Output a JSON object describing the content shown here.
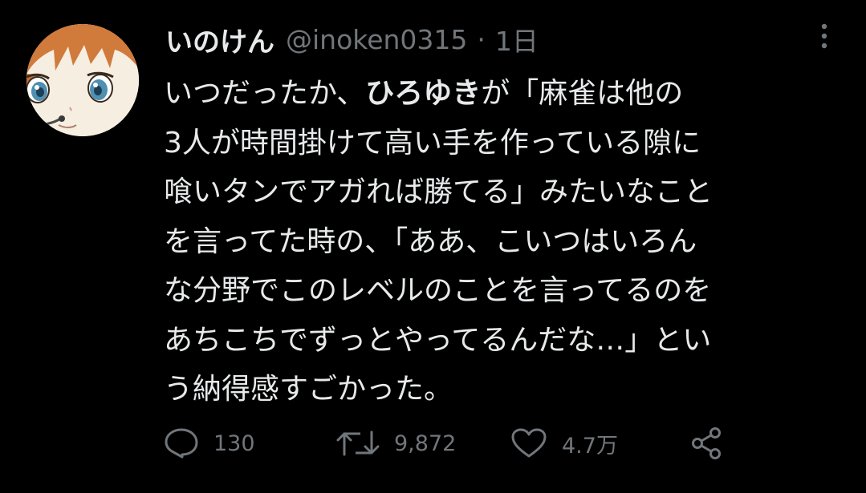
{
  "user": {
    "display_name": "いのけん",
    "handle": "@inoken0315",
    "separator": "·",
    "time": "1日"
  },
  "tweet": {
    "lines": [
      {
        "before": "いつだったか、",
        "mention": "ひろゆき",
        "after": "が「麻雀は他の"
      },
      {
        "text": "3人が時間掛けて高い手を作っている隙に"
      },
      {
        "text": "喰いタンでアガれば勝てる」みたいなこと"
      },
      {
        "text": "を言ってた時の、「ああ、こいつはいろん"
      },
      {
        "text": "な分野でこのレベルのことを言ってるのを"
      },
      {
        "text": "あちこちでずっとやってるんだな…」とい"
      },
      {
        "text": "う納得感すごかった。"
      }
    ]
  },
  "actions": {
    "reply": {
      "icon": "reply-icon",
      "count": "130"
    },
    "retweet": {
      "icon": "retweet-icon",
      "count": "9,872"
    },
    "like": {
      "icon": "heart-icon",
      "count": "4.7万"
    },
    "share": {
      "icon": "share-icon"
    }
  },
  "colors": {
    "background": "#000000",
    "text": "#e7e9ea",
    "secondary": "#71767b"
  }
}
